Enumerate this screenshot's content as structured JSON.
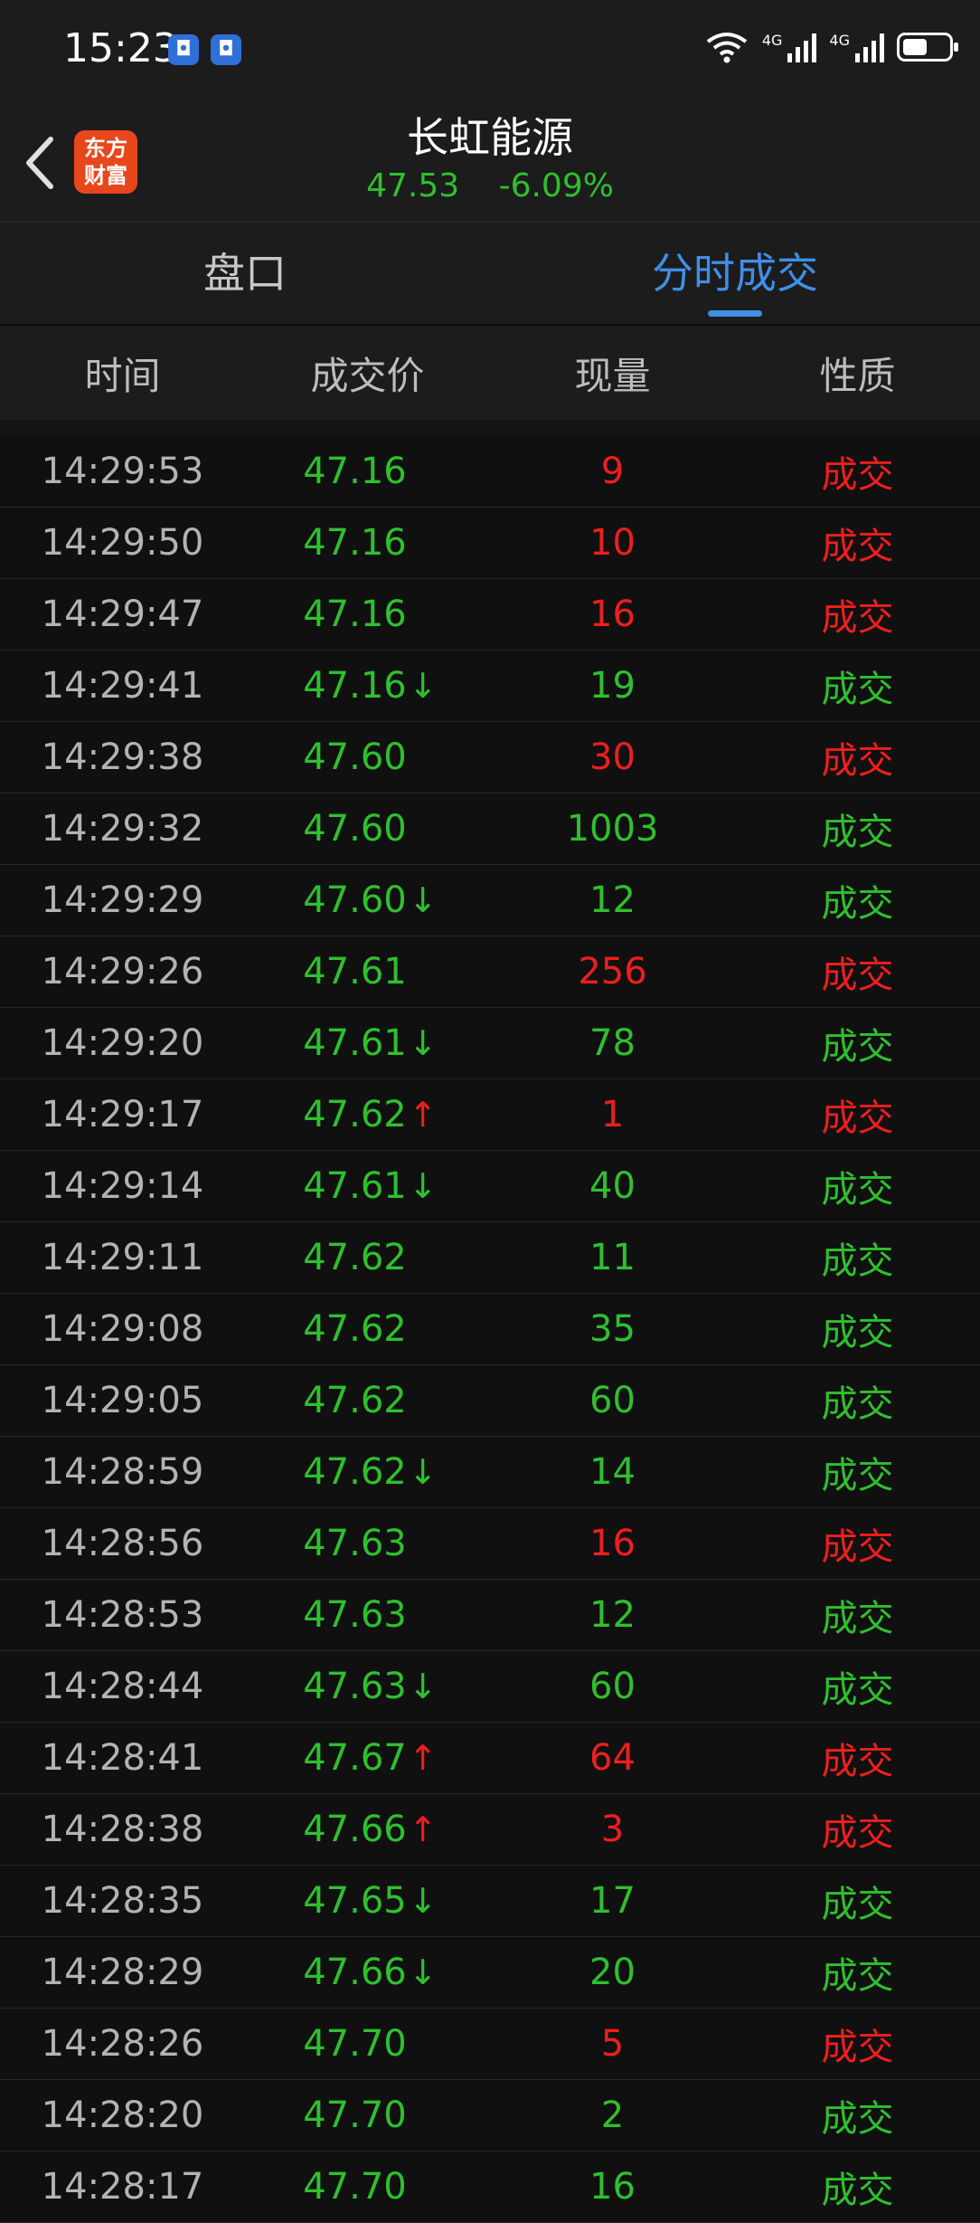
{
  "status_bar": {
    "time": "15:23",
    "icons": [
      "shield-icon",
      "shield-icon",
      "wifi-icon",
      "signal-4g-icon",
      "signal-4g-icon",
      "battery-icon"
    ],
    "net_label_1": "4G",
    "net_label_2": "4G"
  },
  "header": {
    "title": "长虹能源",
    "price": "47.53",
    "change": "-6.09%",
    "logo_line1": "东方",
    "logo_line2": "财富",
    "logo_color": "#e8471c"
  },
  "tabs": [
    {
      "label": "盘口",
      "active": false
    },
    {
      "label": "分时成交",
      "active": true
    }
  ],
  "columns": [
    "时间",
    "成交价",
    "现量",
    "性质"
  ],
  "colors": {
    "up": "#ef1e1e",
    "down": "#2ec02e",
    "accent": "#3f8fe6"
  },
  "trades": [
    {
      "time": "14:29:53",
      "price": "47.16",
      "arrow": "",
      "volume": "9",
      "type": "成交",
      "side": "buy"
    },
    {
      "time": "14:29:50",
      "price": "47.16",
      "arrow": "",
      "volume": "10",
      "type": "成交",
      "side": "buy"
    },
    {
      "time": "14:29:47",
      "price": "47.16",
      "arrow": "",
      "volume": "16",
      "type": "成交",
      "side": "buy"
    },
    {
      "time": "14:29:41",
      "price": "47.16",
      "arrow": "down",
      "volume": "19",
      "type": "成交",
      "side": "sell"
    },
    {
      "time": "14:29:38",
      "price": "47.60",
      "arrow": "",
      "volume": "30",
      "type": "成交",
      "side": "buy"
    },
    {
      "time": "14:29:32",
      "price": "47.60",
      "arrow": "",
      "volume": "1003",
      "type": "成交",
      "side": "sell"
    },
    {
      "time": "14:29:29",
      "price": "47.60",
      "arrow": "down",
      "volume": "12",
      "type": "成交",
      "side": "sell"
    },
    {
      "time": "14:29:26",
      "price": "47.61",
      "arrow": "",
      "volume": "256",
      "type": "成交",
      "side": "buy"
    },
    {
      "time": "14:29:20",
      "price": "47.61",
      "arrow": "down",
      "volume": "78",
      "type": "成交",
      "side": "sell"
    },
    {
      "time": "14:29:17",
      "price": "47.62",
      "arrow": "up",
      "volume": "1",
      "type": "成交",
      "side": "buy"
    },
    {
      "time": "14:29:14",
      "price": "47.61",
      "arrow": "down",
      "volume": "40",
      "type": "成交",
      "side": "sell"
    },
    {
      "time": "14:29:11",
      "price": "47.62",
      "arrow": "",
      "volume": "11",
      "type": "成交",
      "side": "sell"
    },
    {
      "time": "14:29:08",
      "price": "47.62",
      "arrow": "",
      "volume": "35",
      "type": "成交",
      "side": "sell"
    },
    {
      "time": "14:29:05",
      "price": "47.62",
      "arrow": "",
      "volume": "60",
      "type": "成交",
      "side": "sell"
    },
    {
      "time": "14:28:59",
      "price": "47.62",
      "arrow": "down",
      "volume": "14",
      "type": "成交",
      "side": "sell"
    },
    {
      "time": "14:28:56",
      "price": "47.63",
      "arrow": "",
      "volume": "16",
      "type": "成交",
      "side": "buy"
    },
    {
      "time": "14:28:53",
      "price": "47.63",
      "arrow": "",
      "volume": "12",
      "type": "成交",
      "side": "sell"
    },
    {
      "time": "14:28:44",
      "price": "47.63",
      "arrow": "down",
      "volume": "60",
      "type": "成交",
      "side": "sell"
    },
    {
      "time": "14:28:41",
      "price": "47.67",
      "arrow": "up",
      "volume": "64",
      "type": "成交",
      "side": "buy"
    },
    {
      "time": "14:28:38",
      "price": "47.66",
      "arrow": "up",
      "volume": "3",
      "type": "成交",
      "side": "buy"
    },
    {
      "time": "14:28:35",
      "price": "47.65",
      "arrow": "down",
      "volume": "17",
      "type": "成交",
      "side": "sell"
    },
    {
      "time": "14:28:29",
      "price": "47.66",
      "arrow": "down",
      "volume": "20",
      "type": "成交",
      "side": "sell"
    },
    {
      "time": "14:28:26",
      "price": "47.70",
      "arrow": "",
      "volume": "5",
      "type": "成交",
      "side": "buy"
    },
    {
      "time": "14:28:20",
      "price": "47.70",
      "arrow": "",
      "volume": "2",
      "type": "成交",
      "side": "sell"
    },
    {
      "time": "14:28:17",
      "price": "47.70",
      "arrow": "",
      "volume": "16",
      "type": "成交",
      "side": "sell"
    }
  ]
}
